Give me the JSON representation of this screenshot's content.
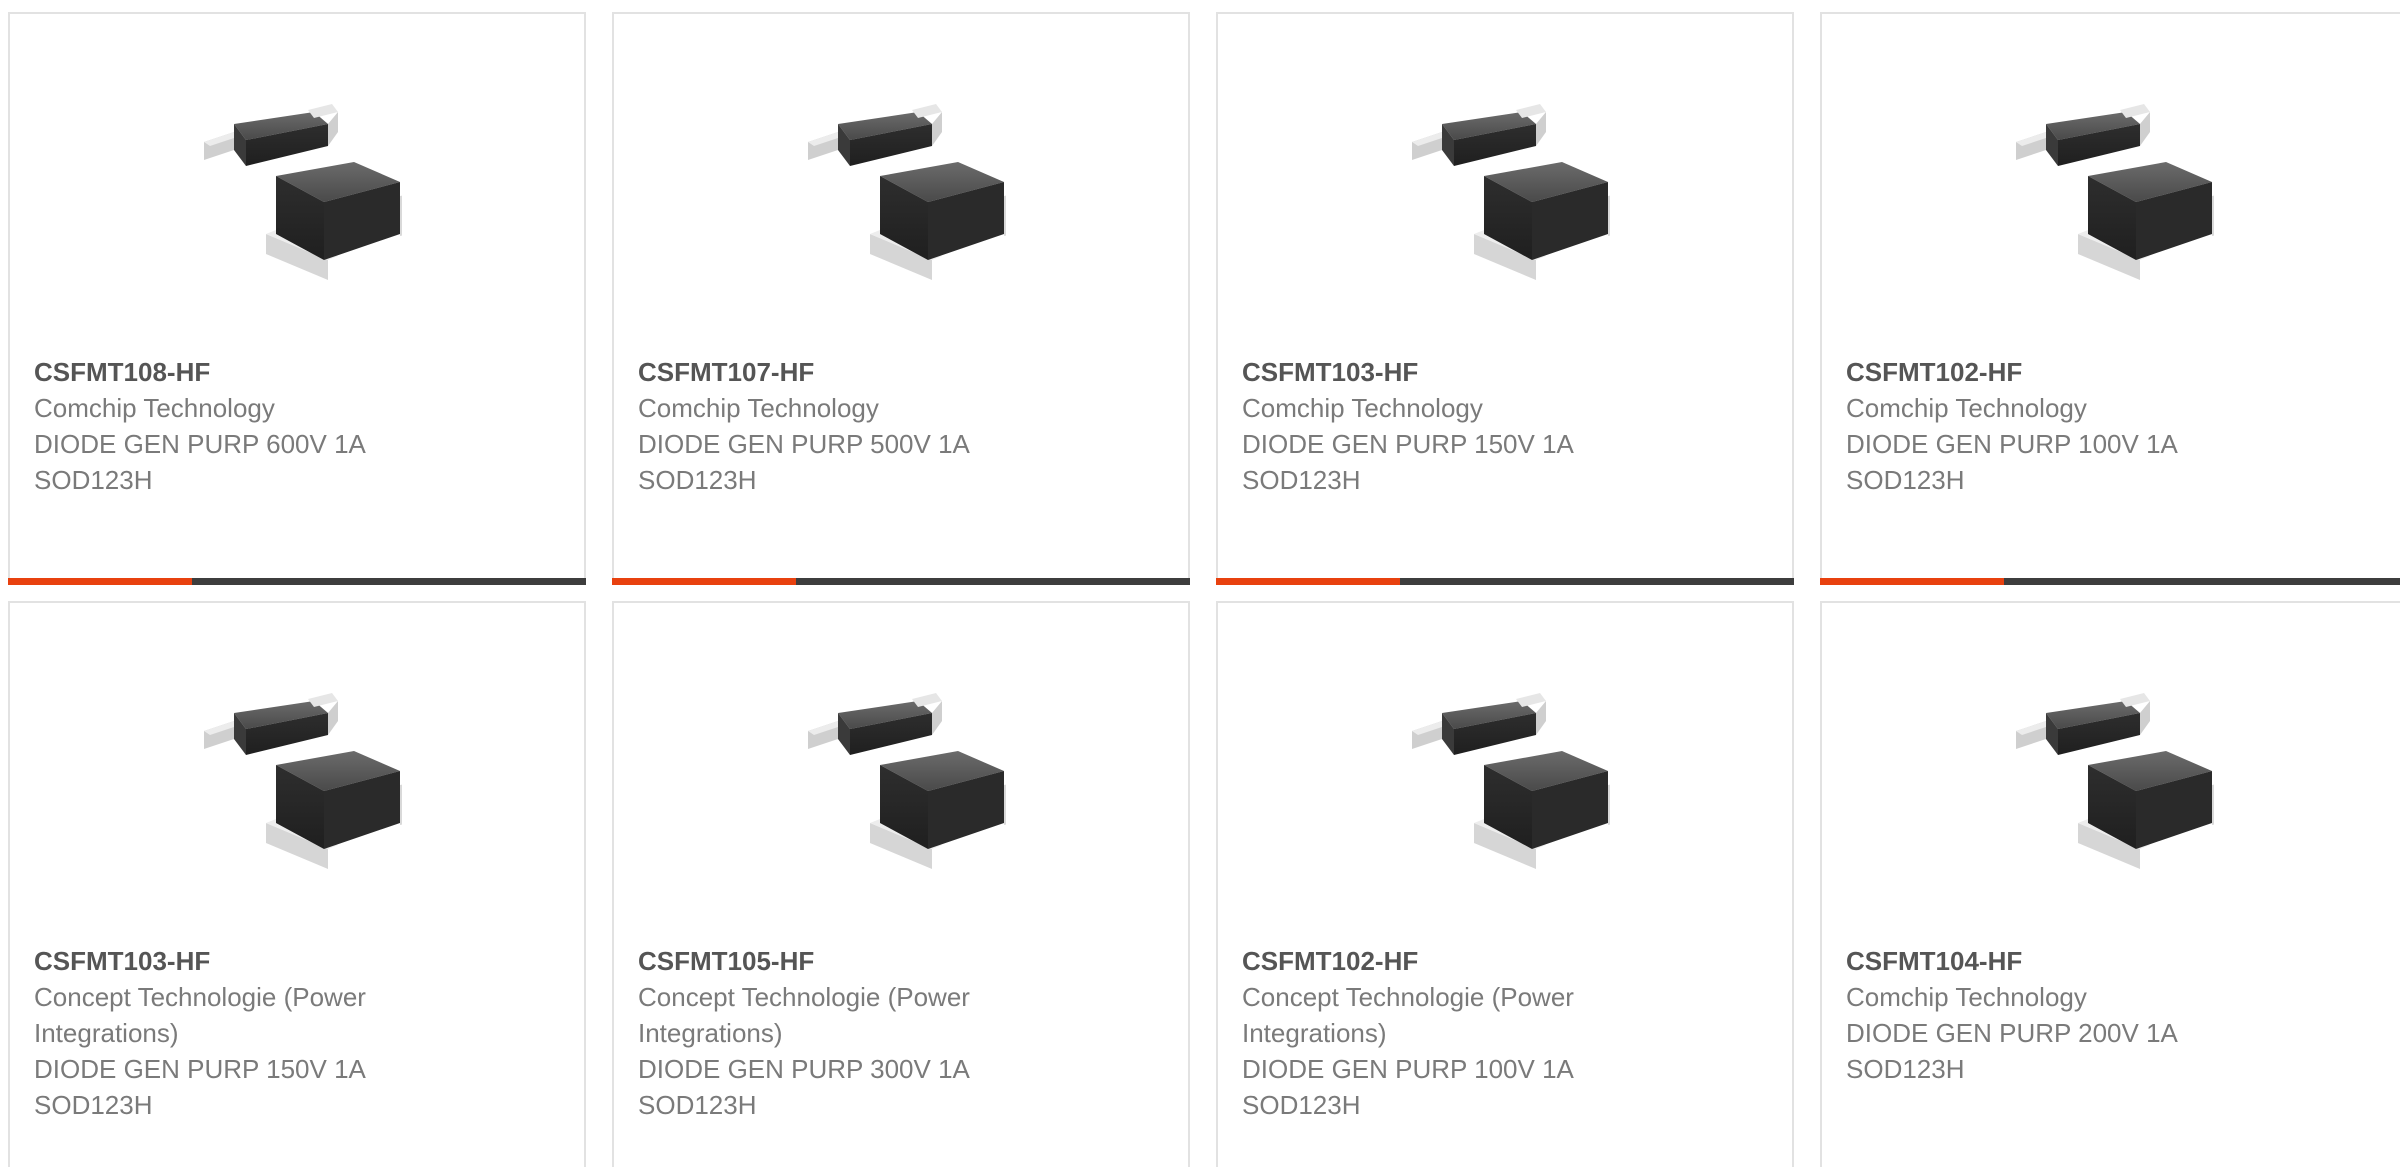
{
  "colors": {
    "accent": "#e8410f",
    "bar": "#3d3d3d",
    "border": "#e2e2e2",
    "text": "#7a7a7a",
    "title": "#555555"
  },
  "products": [
    {
      "part": "CSFMT108-HF",
      "maker": "Comchip Technology",
      "desc": "DIODE GEN PURP 600V 1A",
      "pkg": "SOD123H",
      "icon": "smd-diode-image"
    },
    {
      "part": "CSFMT107-HF",
      "maker": "Comchip Technology",
      "desc": "DIODE GEN PURP 500V 1A",
      "pkg": "SOD123H",
      "icon": "smd-diode-image"
    },
    {
      "part": "CSFMT103-HF",
      "maker": "Comchip Technology",
      "desc": "DIODE GEN PURP 150V 1A",
      "pkg": "SOD123H",
      "icon": "smd-diode-image"
    },
    {
      "part": "CSFMT102-HF",
      "maker": "Comchip Technology",
      "desc": "DIODE GEN PURP 100V 1A",
      "pkg": "SOD123H",
      "icon": "smd-diode-image"
    },
    {
      "part": "CSFMT103-HF",
      "maker": "Concept Technologie (Power Integrations)",
      "desc": "DIODE GEN PURP 150V 1A",
      "pkg": "SOD123H",
      "icon": "smd-diode-image"
    },
    {
      "part": "CSFMT105-HF",
      "maker": "Concept Technologie (Power Integrations)",
      "desc": "DIODE GEN PURP 300V 1A",
      "pkg": "SOD123H",
      "icon": "smd-diode-image"
    },
    {
      "part": "CSFMT102-HF",
      "maker": "Concept Technologie (Power Integrations)",
      "desc": "DIODE GEN PURP 100V 1A",
      "pkg": "SOD123H",
      "icon": "smd-diode-image"
    },
    {
      "part": "CSFMT104-HF",
      "maker": "Comchip Technology",
      "desc": "DIODE GEN PURP 200V 1A",
      "pkg": "SOD123H",
      "icon": "smd-diode-image"
    }
  ]
}
